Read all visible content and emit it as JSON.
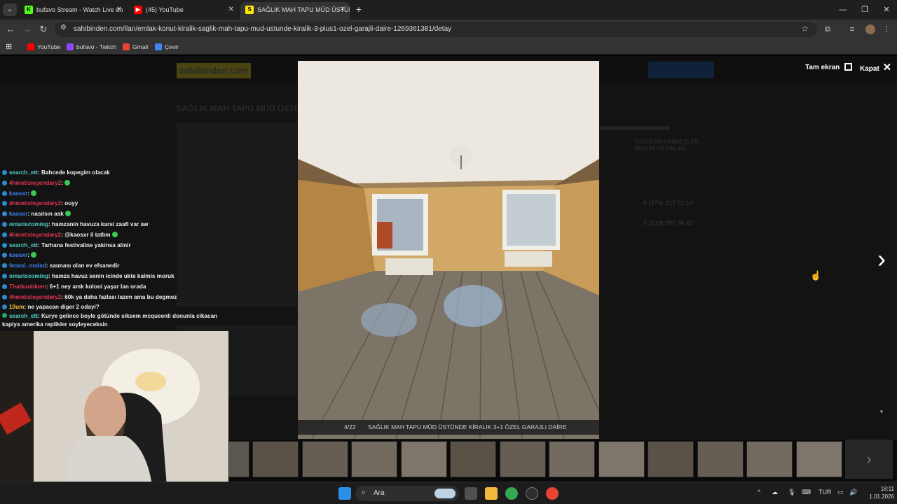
{
  "tabs": [
    {
      "title": "bufavo Stream - Watch Live on",
      "favicon": "kick-icon",
      "active": false
    },
    {
      "title": "(45) YouTube",
      "favicon": "youtube-icon",
      "active": false
    },
    {
      "title": "SAĞLIK MAH TAPU MÜD ÜSTÜN",
      "favicon": "sahibinden-icon",
      "active": true
    }
  ],
  "address_bar": {
    "url": "sahibinden.com/ilan/emlak-konut-kiralik-saglik-mah-tapu-mud-ustunde-kiralik-3-plus1-ozel-garajli-daire-1269361381/detay"
  },
  "bookmarks": [
    {
      "label": "YouTube",
      "color": "#ff0000"
    },
    {
      "label": "bufavo - Twitch",
      "color": "#9146ff"
    },
    {
      "label": "Gmail",
      "color": "#ea4335"
    },
    {
      "label": "Çevir",
      "color": "#4285f4"
    }
  ],
  "site": {
    "logo": "sahibinden.com",
    "title": "SAĞLIK MAH TAPU MÜD ÜSTÜ",
    "seller": "ÖZASLAN KARDEŞLER İNŞAAT VE EMLAK",
    "phone1": "0 (374) 217 01 14",
    "phone2": "0 (533) 597 80 83"
  },
  "gallery": {
    "fullscreen_label": "Tam ekran",
    "close_label": "Kapat",
    "counter": "4/22",
    "caption": "SAĞLIK MAH TAPU MÜD ÜSTÜNDE KİRALIK 3+1 ÖZEL GARAJLI DAİRE",
    "current_index": 4,
    "total": 22,
    "thumb_count": 13
  },
  "chat": [
    {
      "user": "search_ett",
      "text": ": Bahcede kopegim olacak",
      "color": "#4fd1c5",
      "emote": false
    },
    {
      "user": "4hmetislegendary2",
      "text": ":",
      "color": "#e0354f",
      "emote": true
    },
    {
      "user": "kaosxr",
      "text": ":",
      "color": "#3b82f6",
      "emote": true
    },
    {
      "user": "4hmetislegendary2",
      "text": ": ouyy",
      "color": "#e0354f",
      "emote": false
    },
    {
      "user": "kaosxr",
      "text": ": nasılsın ask",
      "color": "#3b82f6",
      "emote": true
    },
    {
      "user": "omariscoming",
      "text": ": hamzanin havuza karsi zaafi var aw",
      "color": "#4fd1c5",
      "emote": false
    },
    {
      "user": "4hmetislegendary2",
      "text": ": @kaosxr il tatlım",
      "color": "#e0354f",
      "emote": true
    },
    {
      "user": "search_ett",
      "text": ": Tarhana festivaline yakinsa alinir",
      "color": "#4fd1c5",
      "emote": false
    },
    {
      "user": "kaosxr",
      "text": ":",
      "color": "#3b82f6",
      "emote": true
    },
    {
      "user": "fenasi_ondad",
      "text": ": saunası olan ev efsanedir",
      "color": "#3b82f6",
      "emote": false
    },
    {
      "user": "omariscoming",
      "text": ": hamza havuz senin icinde ukte kalmis moruk",
      "color": "#4fd1c5",
      "emote": false
    },
    {
      "user": "Thatkanbkem",
      "text": ": 6+1 ney amk koloni yaşar lan orada",
      "color": "#e0354f",
      "emote": false
    },
    {
      "user": "4hmetislegendary2",
      "text": ": 60k ya daha fazlası lazım ama bu degmez",
      "color": "#e0354f",
      "emote": false
    },
    {
      "user": "10um",
      "text": ": ne yapacan diger 2 odayi?",
      "color": "#f5c542",
      "emote": false
    }
  ],
  "chat_last": {
    "user": "search_ett",
    "line1": ": Kurye gelince boyle götünde siksem mcqueenli donunla cikacan",
    "line2": "kapiya amerika replikler soyleyeceksin",
    "color": "#4fd1c5"
  },
  "taskbar": {
    "search_label": "Ara",
    "lang": "TUR",
    "time": "18:11",
    "date": "1.01.2026"
  }
}
